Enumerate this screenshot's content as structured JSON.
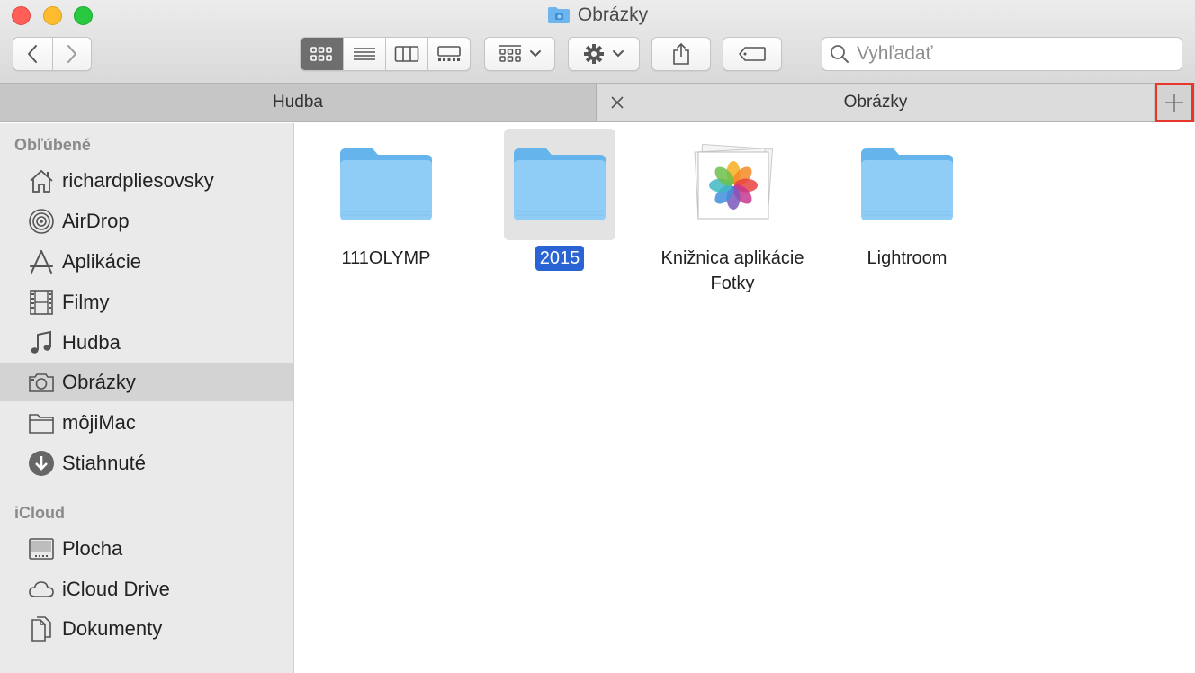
{
  "window": {
    "title": "Obrázky"
  },
  "toolbar": {
    "search_placeholder": "Vyhľadať"
  },
  "tabs": [
    {
      "label": "Hudba",
      "active": false
    },
    {
      "label": "Obrázky",
      "active": true
    }
  ],
  "sidebar": {
    "sections": [
      {
        "heading": "Obľúbené",
        "items": [
          {
            "label": "richardpliesovsky",
            "icon": "home-icon"
          },
          {
            "label": "AirDrop",
            "icon": "airdrop-icon"
          },
          {
            "label": "Aplikácie",
            "icon": "applications-icon"
          },
          {
            "label": "Filmy",
            "icon": "film-icon"
          },
          {
            "label": "Hudba",
            "icon": "music-note-icon"
          },
          {
            "label": "Obrázky",
            "icon": "camera-icon",
            "selected": true
          },
          {
            "label": "môjiMac",
            "icon": "folder-icon"
          },
          {
            "label": "Stiahnuté",
            "icon": "download-icon"
          }
        ]
      },
      {
        "heading": "iCloud",
        "items": [
          {
            "label": "Plocha",
            "icon": "desktop-icon"
          },
          {
            "label": "iCloud Drive",
            "icon": "cloud-icon"
          },
          {
            "label": "Dokumenty",
            "icon": "document-icon"
          }
        ]
      }
    ]
  },
  "files": [
    {
      "label": "111OLYMP",
      "icon": "folder-icon"
    },
    {
      "label": "2015",
      "icon": "folder-icon",
      "selected": true
    },
    {
      "label": "Knižnica aplikácie Fotky",
      "icon": "photos-library-icon"
    },
    {
      "label": "Lightroom",
      "icon": "folder-icon"
    }
  ],
  "colors": {
    "selection": "#2a64d4",
    "highlight_box": "#e6372a",
    "folder": "#7cc4f4"
  }
}
